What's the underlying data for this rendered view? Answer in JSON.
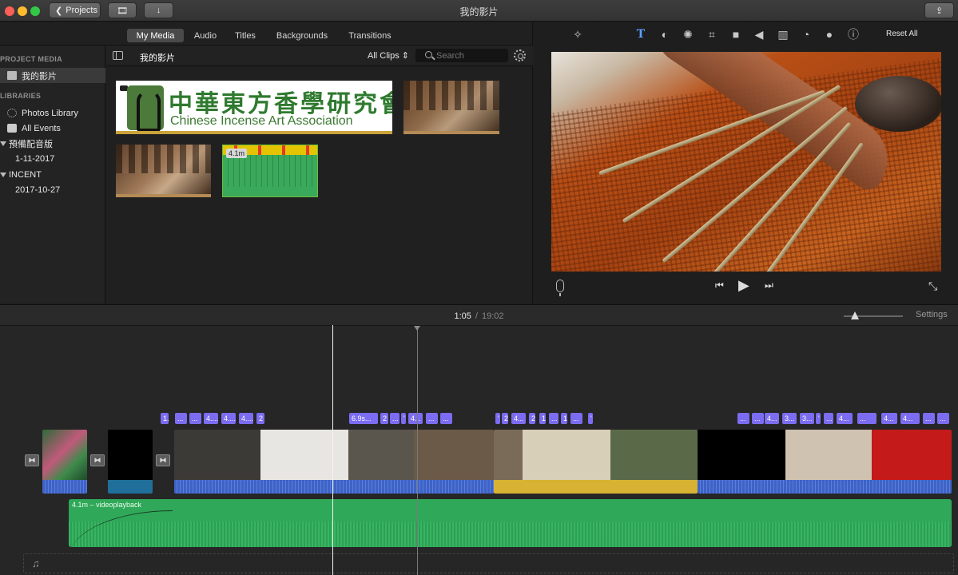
{
  "window": {
    "title": "我的影片"
  },
  "toolbar": {
    "projects_label": "Projects"
  },
  "browser": {
    "tabs": [
      {
        "label": "My Media",
        "active": true
      },
      {
        "label": "Audio"
      },
      {
        "label": "Titles"
      },
      {
        "label": "Backgrounds"
      },
      {
        "label": "Transitions"
      }
    ],
    "event_title": "我的影片",
    "filter": "All Clips",
    "search_placeholder": "Search"
  },
  "sidebar": {
    "project_media_heading": "PROJECT MEDIA",
    "project_item": "我的影片",
    "libraries_heading": "LIBRARIES",
    "photos_library": "Photos Library",
    "all_events": "All Events",
    "library1": {
      "name": "預備配音版",
      "event": "1-11-2017"
    },
    "library2": {
      "name": "INCENT",
      "event": "2017-10-27"
    }
  },
  "media": {
    "logo_chinese": "中華東方香學研究會",
    "logo_english": "Chinese Incense Art Association",
    "audio_duration": "4.1m"
  },
  "viewer": {
    "reset_label": "Reset All",
    "icons": [
      "magic-wand-icon",
      "title-t-icon",
      "color-balance-icon",
      "color-correction-icon",
      "crop-icon",
      "stabilization-icon",
      "volume-icon",
      "equalizer-icon",
      "speed-icon",
      "filter-icon",
      "info-icon"
    ]
  },
  "timeline": {
    "current_time": "1:05",
    "separator": "/",
    "total_time": "19:02",
    "settings_label": "Settings",
    "tags": [
      "1.",
      "...",
      "...",
      "4....",
      "4....",
      "4....",
      "2",
      "6.9s...",
      "2",
      "...",
      "'",
      "4...",
      "...",
      "...",
      "'",
      "2",
      "4...",
      "2",
      "1",
      "...",
      "1",
      "...",
      "'",
      "...",
      "...",
      "4...",
      "3...",
      "3...",
      "'",
      "...",
      "4...",
      "...",
      "4...",
      "4...",
      "...",
      "..."
    ],
    "music_label": "4.1m – videoplayback"
  },
  "colors": {
    "accent_tag": "#7b6cf1",
    "audio_blue": "#3e63c4",
    "music_green": "#2fa859"
  }
}
